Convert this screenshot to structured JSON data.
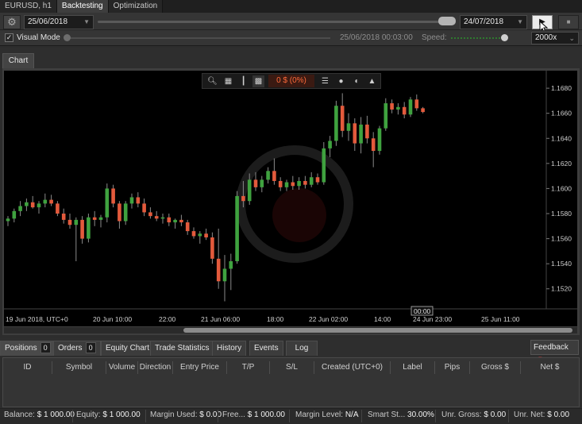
{
  "top_tabs": [
    {
      "label": "EURUSD, h1"
    },
    {
      "label": "Backtesting"
    },
    {
      "label": "Optimization"
    }
  ],
  "toolbar": {
    "start_date": "25/06/2018",
    "end_date": "24/07/2018",
    "range_progress": 0.98
  },
  "visual": {
    "checkbox_label": "Visual Mode",
    "checked": true,
    "current_time": "25/06/2018 00:03:00",
    "speed_label": "Speed:",
    "speed_value": "2000x"
  },
  "chart_tab": "Chart",
  "chart_toolbar": {
    "pnl": "0 $ (0%)",
    "icons": [
      "zoom-icon",
      "period-settings-icon",
      "candles-icon",
      "color-icon",
      "list-icon",
      "facebook-icon",
      "share-icon",
      "drawing-icon"
    ]
  },
  "chart_data": {
    "type": "candlestick",
    "symbol": "EURUSD",
    "timeframe": "h1",
    "y_ticks": [
      "1.1680",
      "1.1660",
      "1.1640",
      "1.1620",
      "1.1600",
      "1.1580",
      "1.1560",
      "1.1540",
      "1.1520"
    ],
    "ylim": [
      1.1504,
      1.1694
    ],
    "x_ticks": [
      "19 Jun 2018, UTC+0",
      "20 Jun 10:00",
      "22:00",
      "21 Jun 06:00",
      "18:00",
      "22 Jun 02:00",
      "14:00",
      "24 Jun 23:00",
      "25 Jun 11:00"
    ],
    "crosshair_label": "00:00",
    "up_color": "#3fa23f",
    "down_color": "#e35a3c",
    "candles": [
      {
        "o": 1.1574,
        "h": 1.1578,
        "l": 1.157,
        "c": 1.1576
      },
      {
        "o": 1.1576,
        "h": 1.1584,
        "l": 1.1573,
        "c": 1.1582
      },
      {
        "o": 1.1582,
        "h": 1.159,
        "l": 1.1578,
        "c": 1.1586
      },
      {
        "o": 1.1586,
        "h": 1.1592,
        "l": 1.1582,
        "c": 1.1589
      },
      {
        "o": 1.1589,
        "h": 1.1594,
        "l": 1.1584,
        "c": 1.1585
      },
      {
        "o": 1.1585,
        "h": 1.159,
        "l": 1.158,
        "c": 1.1588
      },
      {
        "o": 1.1588,
        "h": 1.1596,
        "l": 1.1585,
        "c": 1.1591
      },
      {
        "o": 1.1591,
        "h": 1.1595,
        "l": 1.1586,
        "c": 1.1588
      },
      {
        "o": 1.1588,
        "h": 1.159,
        "l": 1.1578,
        "c": 1.158
      },
      {
        "o": 1.158,
        "h": 1.1584,
        "l": 1.1572,
        "c": 1.1575
      },
      {
        "o": 1.1575,
        "h": 1.158,
        "l": 1.1568,
        "c": 1.1571
      },
      {
        "o": 1.1571,
        "h": 1.1577,
        "l": 1.1542,
        "c": 1.1575
      },
      {
        "o": 1.1575,
        "h": 1.1578,
        "l": 1.1556,
        "c": 1.156
      },
      {
        "o": 1.156,
        "h": 1.158,
        "l": 1.1557,
        "c": 1.1577
      },
      {
        "o": 1.1577,
        "h": 1.1582,
        "l": 1.157,
        "c": 1.1575
      },
      {
        "o": 1.1575,
        "h": 1.1579,
        "l": 1.1569,
        "c": 1.1577
      },
      {
        "o": 1.1577,
        "h": 1.1604,
        "l": 1.1573,
        "c": 1.16
      },
      {
        "o": 1.16,
        "h": 1.1603,
        "l": 1.1585,
        "c": 1.1588
      },
      {
        "o": 1.1588,
        "h": 1.159,
        "l": 1.1568,
        "c": 1.1574
      },
      {
        "o": 1.1574,
        "h": 1.159,
        "l": 1.1571,
        "c": 1.1588
      },
      {
        "o": 1.1588,
        "h": 1.1596,
        "l": 1.1584,
        "c": 1.1593
      },
      {
        "o": 1.1593,
        "h": 1.1597,
        "l": 1.1585,
        "c": 1.1588
      },
      {
        "o": 1.1588,
        "h": 1.1592,
        "l": 1.1578,
        "c": 1.1581
      },
      {
        "o": 1.1581,
        "h": 1.1585,
        "l": 1.1576,
        "c": 1.1578
      },
      {
        "o": 1.1578,
        "h": 1.1582,
        "l": 1.1574,
        "c": 1.1576
      },
      {
        "o": 1.1576,
        "h": 1.158,
        "l": 1.1572,
        "c": 1.1577
      },
      {
        "o": 1.1577,
        "h": 1.158,
        "l": 1.157,
        "c": 1.1573
      },
      {
        "o": 1.1573,
        "h": 1.1576,
        "l": 1.1568,
        "c": 1.1575
      },
      {
        "o": 1.1575,
        "h": 1.1579,
        "l": 1.157,
        "c": 1.1573
      },
      {
        "o": 1.1573,
        "h": 1.1575,
        "l": 1.1563,
        "c": 1.1566
      },
      {
        "o": 1.1566,
        "h": 1.1569,
        "l": 1.156,
        "c": 1.1562
      },
      {
        "o": 1.1562,
        "h": 1.1566,
        "l": 1.1556,
        "c": 1.1564
      },
      {
        "o": 1.1564,
        "h": 1.1568,
        "l": 1.1559,
        "c": 1.1561
      },
      {
        "o": 1.1561,
        "h": 1.1565,
        "l": 1.154,
        "c": 1.1544
      },
      {
        "o": 1.1544,
        "h": 1.1568,
        "l": 1.152,
        "c": 1.1526
      },
      {
        "o": 1.1526,
        "h": 1.1547,
        "l": 1.151,
        "c": 1.1536
      },
      {
        "o": 1.1536,
        "h": 1.1548,
        "l": 1.1519,
        "c": 1.1542
      },
      {
        "o": 1.1542,
        "h": 1.1598,
        "l": 1.154,
        "c": 1.1594
      },
      {
        "o": 1.1594,
        "h": 1.1606,
        "l": 1.1585,
        "c": 1.159
      },
      {
        "o": 1.159,
        "h": 1.1612,
        "l": 1.1587,
        "c": 1.1607
      },
      {
        "o": 1.1607,
        "h": 1.1613,
        "l": 1.1598,
        "c": 1.1601
      },
      {
        "o": 1.1601,
        "h": 1.161,
        "l": 1.1597,
        "c": 1.1607
      },
      {
        "o": 1.1607,
        "h": 1.1617,
        "l": 1.1604,
        "c": 1.1614
      },
      {
        "o": 1.1614,
        "h": 1.1624,
        "l": 1.1603,
        "c": 1.1606
      },
      {
        "o": 1.1606,
        "h": 1.1609,
        "l": 1.1598,
        "c": 1.1601
      },
      {
        "o": 1.1601,
        "h": 1.1607,
        "l": 1.1598,
        "c": 1.1605
      },
      {
        "o": 1.1605,
        "h": 1.161,
        "l": 1.1599,
        "c": 1.1602
      },
      {
        "o": 1.1602,
        "h": 1.1609,
        "l": 1.1599,
        "c": 1.1606
      },
      {
        "o": 1.1606,
        "h": 1.161,
        "l": 1.16,
        "c": 1.1603
      },
      {
        "o": 1.1603,
        "h": 1.1613,
        "l": 1.1601,
        "c": 1.1609
      },
      {
        "o": 1.1609,
        "h": 1.1612,
        "l": 1.1603,
        "c": 1.1605
      },
      {
        "o": 1.1605,
        "h": 1.1637,
        "l": 1.1603,
        "c": 1.1632
      },
      {
        "o": 1.1632,
        "h": 1.1642,
        "l": 1.1625,
        "c": 1.1638
      },
      {
        "o": 1.1638,
        "h": 1.167,
        "l": 1.1634,
        "c": 1.1666
      },
      {
        "o": 1.1666,
        "h": 1.1676,
        "l": 1.1641,
        "c": 1.1646
      },
      {
        "o": 1.1646,
        "h": 1.166,
        "l": 1.1638,
        "c": 1.1652
      },
      {
        "o": 1.1652,
        "h": 1.1656,
        "l": 1.163,
        "c": 1.1636
      },
      {
        "o": 1.1636,
        "h": 1.1657,
        "l": 1.1628,
        "c": 1.1651
      },
      {
        "o": 1.1651,
        "h": 1.1658,
        "l": 1.1636,
        "c": 1.164
      },
      {
        "o": 1.164,
        "h": 1.1645,
        "l": 1.1617,
        "c": 1.163
      },
      {
        "o": 1.163,
        "h": 1.165,
        "l": 1.1627,
        "c": 1.1648
      },
      {
        "o": 1.1648,
        "h": 1.1672,
        "l": 1.1646,
        "c": 1.1668
      },
      {
        "o": 1.1668,
        "h": 1.1671,
        "l": 1.166,
        "c": 1.1663
      },
      {
        "o": 1.1663,
        "h": 1.1668,
        "l": 1.1659,
        "c": 1.1665
      },
      {
        "o": 1.1665,
        "h": 1.1669,
        "l": 1.1656,
        "c": 1.1659
      },
      {
        "o": 1.1659,
        "h": 1.1673,
        "l": 1.1657,
        "c": 1.1671
      },
      {
        "o": 1.1671,
        "h": 1.1675,
        "l": 1.1662,
        "c": 1.1664
      },
      {
        "o": 1.1664,
        "h": 1.1665,
        "l": 1.166,
        "c": 1.1661
      }
    ]
  },
  "bottom_tabs": [
    {
      "label": "Positions",
      "badge": "0"
    },
    {
      "label": "Orders",
      "badge": "0"
    },
    {
      "label": "Equity Chart"
    },
    {
      "label": "Trade Statistics"
    },
    {
      "label": "History"
    },
    {
      "label": "Events"
    },
    {
      "label": "Log"
    }
  ],
  "feedback_label": "Feedback",
  "positions_columns": [
    "ID",
    "Symbol",
    "Volume",
    "Direction",
    "Entry Price",
    "T/P",
    "S/L",
    "Created (UTC+0)",
    "Label",
    "Pips",
    "Gross $",
    "Net $"
  ],
  "status": {
    "balance_label": "Balance:",
    "balance": "$ 1 000.00",
    "equity_label": "Equity:",
    "equity": "$ 1 000.00",
    "margin_used_label": "Margin Used:",
    "margin_used": "$ 0.00",
    "free_label": "Free...",
    "free": "$ 1 000.00",
    "margin_level_label": "Margin Level:",
    "margin_level": "N/A",
    "smart_label": "Smart St...",
    "smart": "30.00%",
    "unr_gross_label": "Unr. Gross:",
    "unr_gross": "$ 0.00",
    "unr_net_label": "Unr. Net:",
    "unr_net": "$ 0.00"
  }
}
